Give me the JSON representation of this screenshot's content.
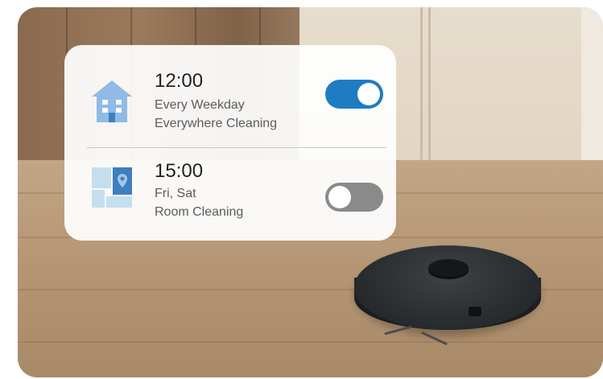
{
  "schedules": [
    {
      "time": "12:00",
      "days": "Every Weekday",
      "mode": "Everywhere Cleaning",
      "icon": "house-icon",
      "enabled": true
    },
    {
      "time": "15:00",
      "days": "Fri, Sat",
      "mode": "Room Cleaning",
      "icon": "room-map-icon",
      "enabled": false
    }
  ],
  "colors": {
    "toggle_on": "#1e7dc2",
    "toggle_off": "#8a8a8a",
    "icon_blue": "#8fbbe6",
    "icon_dark_blue": "#3d7fc1"
  }
}
